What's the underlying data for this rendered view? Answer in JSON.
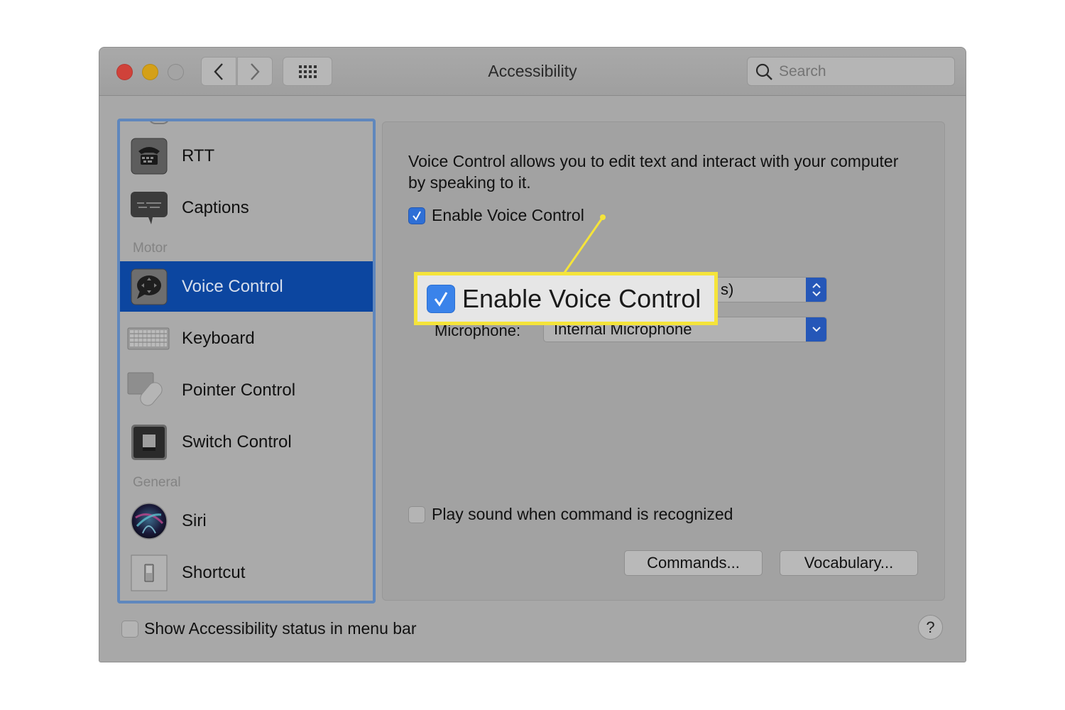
{
  "window": {
    "title": "Accessibility",
    "search_placeholder": "Search"
  },
  "sidebar": {
    "items": [
      {
        "label": "RTT",
        "icon": "rtt-phone-icon"
      },
      {
        "label": "Captions",
        "icon": "captions-icon"
      },
      {
        "header": "Motor"
      },
      {
        "label": "Voice Control",
        "icon": "voice-control-icon",
        "selected": true
      },
      {
        "label": "Keyboard",
        "icon": "keyboard-icon"
      },
      {
        "label": "Pointer Control",
        "icon": "pointer-control-icon"
      },
      {
        "label": "Switch Control",
        "icon": "switch-control-icon"
      },
      {
        "header": "General"
      },
      {
        "label": "Siri",
        "icon": "siri-icon"
      },
      {
        "label": "Shortcut",
        "icon": "shortcut-icon"
      }
    ]
  },
  "pane": {
    "description": "Voice Control allows you to edit text and interact with your computer by speaking to it.",
    "enable_voice_control": {
      "label": "Enable Voice Control",
      "checked": true
    },
    "language_popup": {
      "visible_value_fragment": "s)"
    },
    "microphone": {
      "label": "Microphone:",
      "value": "Internal Microphone"
    },
    "play_sound": {
      "label": "Play sound when command is recognized",
      "checked": false
    },
    "buttons": {
      "commands": "Commands...",
      "vocabulary": "Vocabulary..."
    }
  },
  "footer": {
    "show_status": {
      "label": "Show Accessibility status in menu bar",
      "checked": false
    },
    "help": "?"
  },
  "callout": {
    "label": "Enable Voice Control",
    "checked": true,
    "highlight_color": "#f5e43a"
  },
  "colors": {
    "selection": "#0c46a0",
    "checkbox_accent": "#2e6fd6",
    "popup_accent": "#2557b8",
    "close": "#d0423a",
    "minimize": "#d4a018"
  }
}
